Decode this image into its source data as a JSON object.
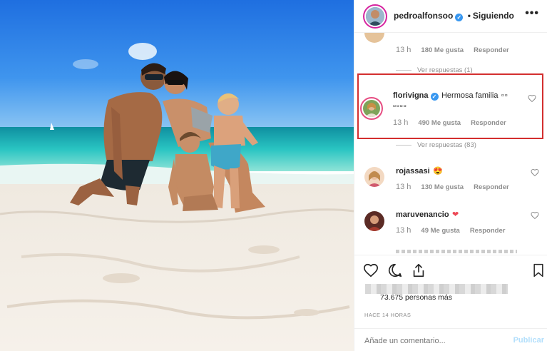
{
  "post": {
    "author": "pedroalfonsoo",
    "follow_state": "Siguiendo",
    "separator": "•",
    "more_label": "•••"
  },
  "comments": [
    {
      "time": "13 h",
      "likes": "180 Me gusta",
      "reply": "Responder",
      "view_replies": "Ver respuestas (1)"
    },
    {
      "user": "florivigna",
      "verified": true,
      "text": "Hermosa familia",
      "emoji": "▫▫",
      "emoji2": "▫▫▫▫",
      "time": "13 h",
      "likes": "490 Me gusta",
      "reply": "Responder",
      "view_replies": "Ver respuestas (83)"
    },
    {
      "user": "rojassasi",
      "emoji": "😍",
      "time": "13 h",
      "likes": "130 Me gusta",
      "reply": "Responder"
    },
    {
      "user": "maruvenancio",
      "emoji": "❤",
      "time": "13 h",
      "likes": "49 Me gusta",
      "reply": "Responder"
    }
  ],
  "stats": {
    "likes_text": "73.675 personas más",
    "ago": "HACE 14 HORAS"
  },
  "composer": {
    "placeholder": "Añade un comentario...",
    "publish": "Publicar"
  },
  "colors": {
    "verified": "#3897f0",
    "highlight": "#d32f2f",
    "heart": "#ed4956",
    "publish": "#b2dffc"
  }
}
